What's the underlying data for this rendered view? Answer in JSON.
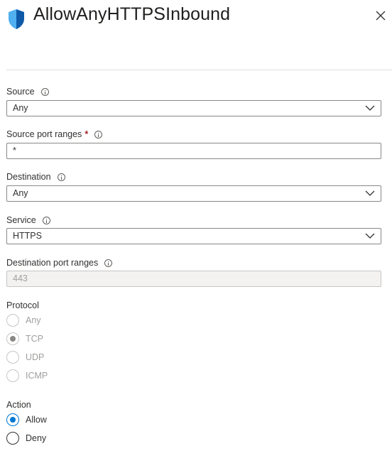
{
  "header": {
    "title": "AllowAnyHTTPSInbound",
    "shield_icon": "shield-icon",
    "close_icon": "close-icon"
  },
  "fields": {
    "source": {
      "label": "Source",
      "value": "Any"
    },
    "source_port_ranges": {
      "label": "Source port ranges",
      "required_mark": "*",
      "value": "*"
    },
    "destination": {
      "label": "Destination",
      "value": "Any"
    },
    "service": {
      "label": "Service",
      "value": "HTTPS"
    },
    "destination_port_ranges": {
      "label": "Destination port ranges",
      "value": "443"
    }
  },
  "protocol": {
    "label": "Protocol",
    "options": [
      "Any",
      "TCP",
      "UDP",
      "ICMP"
    ],
    "selected": "TCP",
    "disabled": true
  },
  "action": {
    "label": "Action",
    "options": [
      "Allow",
      "Deny"
    ],
    "selected": "Allow"
  },
  "colors": {
    "accent": "#0078d4",
    "shield_dark": "#0f5aa8",
    "shield_light": "#50b0f0",
    "required": "#a4262c"
  }
}
